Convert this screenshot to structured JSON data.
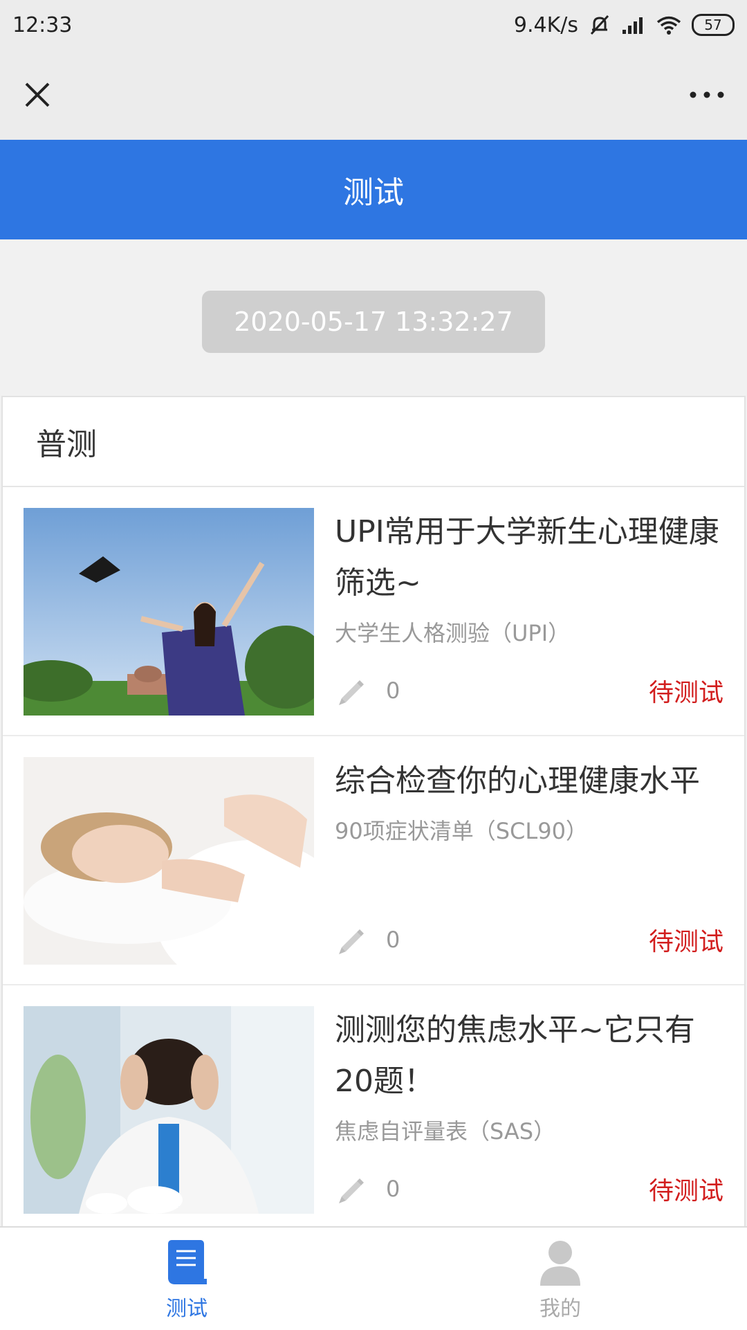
{
  "status_bar": {
    "time": "12:33",
    "network_speed": "9.4K/s",
    "battery": "57"
  },
  "header": {
    "title": "测试"
  },
  "timestamp": "2020-05-17 13:32:27",
  "section": {
    "title": "普测"
  },
  "items": [
    {
      "title": "UPI常用于大学新生心理健康筛选~",
      "subtitle": "大学生人格测验（UPI）",
      "count": "0",
      "status": "待测试",
      "image": "graduate-photo"
    },
    {
      "title": "综合检查你的心理健康水平",
      "subtitle": "90项症状清单（SCL90）",
      "count": "0",
      "status": "待测试",
      "image": "sleeping-woman-photo"
    },
    {
      "title": "测测您的焦虑水平~它只有20题！",
      "subtitle": "焦虑自评量表（SAS）",
      "count": "0",
      "status": "待测试",
      "image": "stressed-man-photo"
    }
  ],
  "tabbar": [
    {
      "label": "测试",
      "icon": "book-icon",
      "active": true
    },
    {
      "label": "我的",
      "icon": "user-icon",
      "active": false
    }
  ],
  "colors": {
    "accent": "#2e76e2",
    "status": "#d21e1e",
    "muted": "#999999"
  }
}
